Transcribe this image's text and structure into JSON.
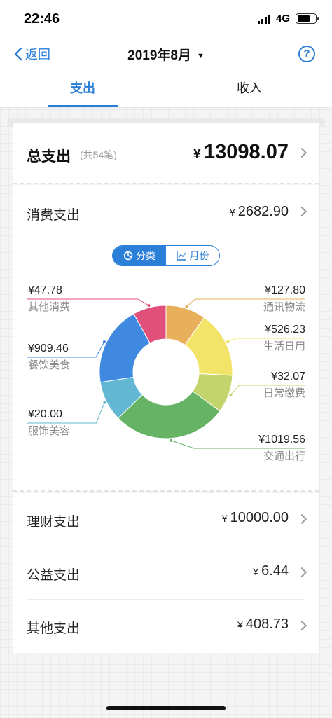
{
  "status": {
    "time": "22:46",
    "network": "4G"
  },
  "nav": {
    "back_label": "返回",
    "title": "2019年8月",
    "caret": "▼",
    "help": "?"
  },
  "tabs": [
    {
      "label": "支出"
    },
    {
      "label": "收入"
    }
  ],
  "total": {
    "label": "总支出",
    "count": "(共54笔)",
    "currency": "¥",
    "amount": "13098.07"
  },
  "consume": {
    "label": "消费支出",
    "currency": "¥",
    "amount": "2682.90"
  },
  "toggle": {
    "category_label": "分类",
    "month_label": "月份"
  },
  "chart_data": {
    "type": "pie",
    "series": [
      {
        "name": "通讯物流",
        "value": 127.8,
        "value_label": "¥127.80",
        "color": "#e8b05a"
      },
      {
        "name": "生活日用",
        "value": 526.23,
        "value_label": "¥526.23",
        "color": "#f2e468"
      },
      {
        "name": "日常缴费",
        "value": 32.07,
        "value_label": "¥32.07",
        "color": "#c3d46c"
      },
      {
        "name": "交通出行",
        "value": 1019.56,
        "value_label": "¥1019.56",
        "color": "#66b366"
      },
      {
        "name": "服饰美容",
        "value": 20.0,
        "value_label": "¥20.00",
        "color": "#62b8d4"
      },
      {
        "name": "餐饮美食",
        "value": 909.46,
        "value_label": "¥909.46",
        "color": "#3f8ae0"
      },
      {
        "name": "其他消费",
        "value": 47.78,
        "value_label": "¥47.78",
        "color": "#e0507a"
      }
    ]
  },
  "rows": [
    {
      "label": "理财支出",
      "currency": "¥",
      "amount": "10000.00"
    },
    {
      "label": "公益支出",
      "currency": "¥",
      "amount": "6.44"
    },
    {
      "label": "其他支出",
      "currency": "¥",
      "amount": "408.73"
    }
  ],
  "colors": {
    "accent": "#2b7fd8"
  }
}
